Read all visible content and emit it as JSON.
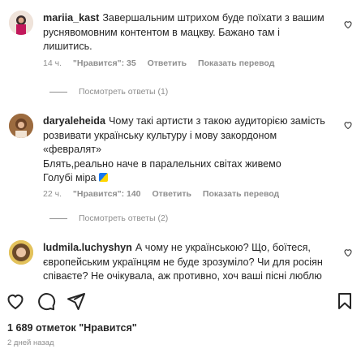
{
  "comments": [
    {
      "username": "mariia_kast",
      "text": "Завершальним штрихом буде поїхати з вашим руснявомовним контентом в мацкву. Бажано там і лишитись.",
      "time": "14 ч.",
      "likes": "\"Нравится\": 35",
      "reply": "Ответить",
      "translate": "Показать перевод",
      "view_replies": "Посмотреть ответы (1)"
    },
    {
      "username": "daryaleheida",
      "text": "Чому такі артисти з такою аудиторією замість розвивати українську культуру і мову закордоном «февралят»",
      "text2": "Блять,реально наче в паралельних світах живемо",
      "text3": "Голубі міра",
      "time": "22 ч.",
      "likes": "\"Нравится\": 140",
      "reply": "Ответить",
      "translate": "Показать перевод",
      "view_replies": "Посмотреть ответы (2)"
    },
    {
      "username": "ludmila.luchyshyn",
      "text": "А чому не українською? Що, боїтеся, європейським українцям не буде зрозуміло? Чи для росіян співаєте? Не очікувала, аж противно, хоч ваші пісні люблю"
    }
  ],
  "post": {
    "likes_count": "1 689 отметок \"Нравится\"",
    "date": "2 дней назад"
  },
  "icons": {
    "like": "heart-icon",
    "comment": "comment-icon",
    "share": "paper-plane-icon",
    "save": "bookmark-icon"
  }
}
